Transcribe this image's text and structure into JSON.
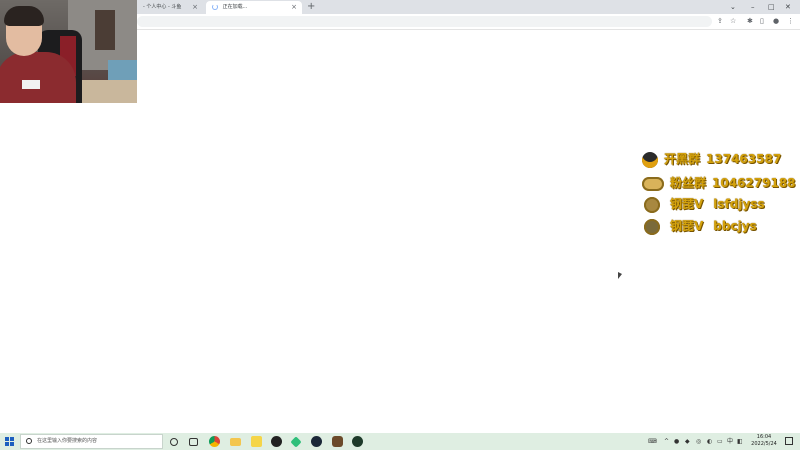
{
  "browser": {
    "tabs": [
      {
        "label": "- 个人中心 - 斗鱼",
        "active": false
      },
      {
        "label": "正在加载...",
        "active": true
      }
    ],
    "new_tab": "+",
    "window_controls": {
      "minimize": "–",
      "maximize": "□",
      "close": "✕"
    },
    "tab_close": "×"
  },
  "toolbar_icons": [
    "share-icon",
    "star-icon",
    "extensions-icon",
    "sidebar-icon",
    "profile-icon",
    "menu-icon"
  ],
  "overlay": {
    "rows": [
      {
        "icon": "qq-penguin-icon",
        "label": "开黑群",
        "value": "137463587"
      },
      {
        "icon": "fan-badge-icon",
        "label": "粉丝群",
        "value": "1046279188"
      },
      {
        "icon": "king-avatar-icon",
        "label": "钢琵V",
        "value": "lsfdjyss"
      },
      {
        "icon": "hat-avatar-icon",
        "label": "钢琵V",
        "value": "bbcjys"
      }
    ],
    "color": "#d4a20c"
  },
  "taskbar": {
    "search_placeholder": "在这里输入你要搜索的内容",
    "apps": [
      "cortana-icon",
      "task-view-icon",
      "chrome-icon",
      "file-explorer-icon",
      "sticky-notes-icon",
      "qq-icon",
      "gem-app-icon",
      "steam-icon",
      "game-app-icon",
      "game-app-2-icon"
    ],
    "clock_time": "16:04",
    "clock_date": "2022/5/24"
  }
}
